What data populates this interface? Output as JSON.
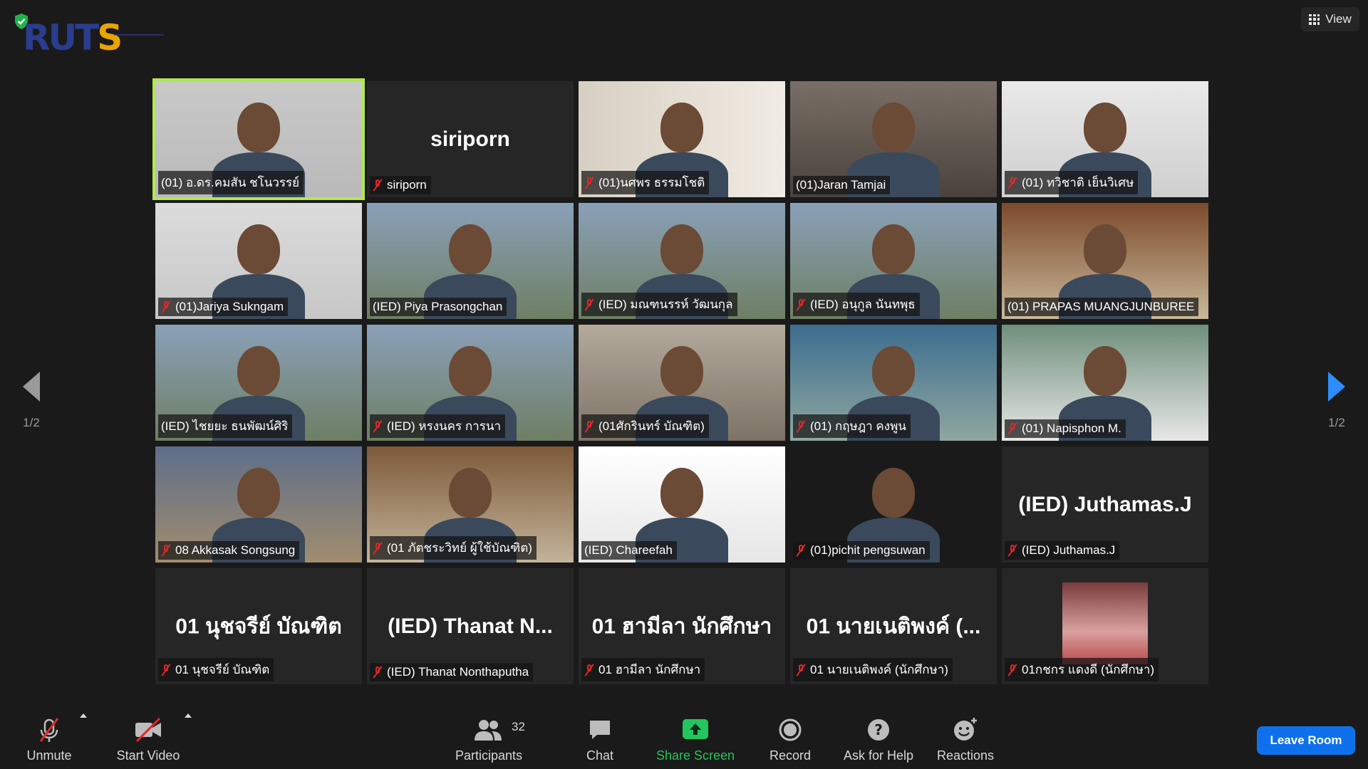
{
  "app": {
    "logo_text_1": "RUT",
    "logo_text_2": "S",
    "view_label": "View"
  },
  "pagination": {
    "left_label": "1/2",
    "right_label": "1/2"
  },
  "tiles": [
    {
      "center": "",
      "label": "(01) อ.ดร.คมสัน ชโนวรรย์",
      "muted": false,
      "active": true
    },
    {
      "center": "siriporn",
      "label": "siriporn",
      "muted": true
    },
    {
      "center": "",
      "label": "(01)นศพร ธรรมโชติ",
      "muted": true
    },
    {
      "center": "",
      "label": "(01)Jaran Tamjai",
      "muted": false
    },
    {
      "center": "",
      "label": "(01) ทวิชาติ เย็นวิเศษ",
      "muted": true
    },
    {
      "center": "",
      "label": "(01)Jariya Sukngam",
      "muted": true
    },
    {
      "center": "",
      "label": "(IED) Piya Prasongchan",
      "muted": false
    },
    {
      "center": "",
      "label": "(IED) มณฑนรรห์ วัฒนกุล",
      "muted": true
    },
    {
      "center": "",
      "label": "(IED) อนุกูล นันทพุธ",
      "muted": true
    },
    {
      "center": "",
      "label": "(01) PRAPAS MUANGJUNBUREE",
      "muted": false
    },
    {
      "center": "",
      "label": "(IED) ไชยยะ ธนพัฒน์ศิริ",
      "muted": false
    },
    {
      "center": "",
      "label": "(IED) หรงนคร การนา",
      "muted": true
    },
    {
      "center": "",
      "label": "(01ศักรินทร์ บัณฑิต)",
      "muted": true
    },
    {
      "center": "",
      "label": "(01) กฤษฎา คงพูน",
      "muted": true
    },
    {
      "center": "",
      "label": "(01) Napisphon M.",
      "muted": true
    },
    {
      "center": "",
      "label": "08 Akkasak Songsung",
      "muted": true
    },
    {
      "center": "",
      "label": "(01 ภัตชระวิทย์ ผู้ใช้บัณฑิต)",
      "muted": true
    },
    {
      "center": "",
      "label": "(IED) Chareefah",
      "muted": false
    },
    {
      "center": "",
      "label": "(01)pichit pengsuwan",
      "muted": true
    },
    {
      "center": "(IED) Juthamas.J",
      "label": "(IED) Juthamas.J",
      "muted": true
    },
    {
      "center": "01 นุชจรีย์ บัณฑิต",
      "label": "01 นุชจรีย์ บัณฑิต",
      "muted": true
    },
    {
      "center": "(IED) Thanat N...",
      "label": "(IED) Thanat Nonthaputha",
      "muted": true
    },
    {
      "center": "01 ฮามีลา นักศึกษา",
      "label": "01 ฮามีลา นักศึกษา",
      "muted": true
    },
    {
      "center": "01 นายเนติพงค์ (...",
      "label": "01 นายเนติพงค์ (นักศึกษา)",
      "muted": true
    },
    {
      "center": "",
      "label": "01กชกร แดงดี (นักศึกษา)",
      "muted": true
    }
  ],
  "toolbar": {
    "unmute": "Unmute",
    "start_video": "Start Video",
    "participants": "Participants",
    "participants_count": "32",
    "chat": "Chat",
    "share_screen": "Share Screen",
    "record": "Record",
    "ask_for_help": "Ask for Help",
    "reactions": "Reactions",
    "leave_room": "Leave Room"
  },
  "colors": {
    "active_speaker": "#b2e651",
    "share_green": "#22c55e",
    "leave_blue": "#0e71eb",
    "muted_red": "#e02828"
  }
}
